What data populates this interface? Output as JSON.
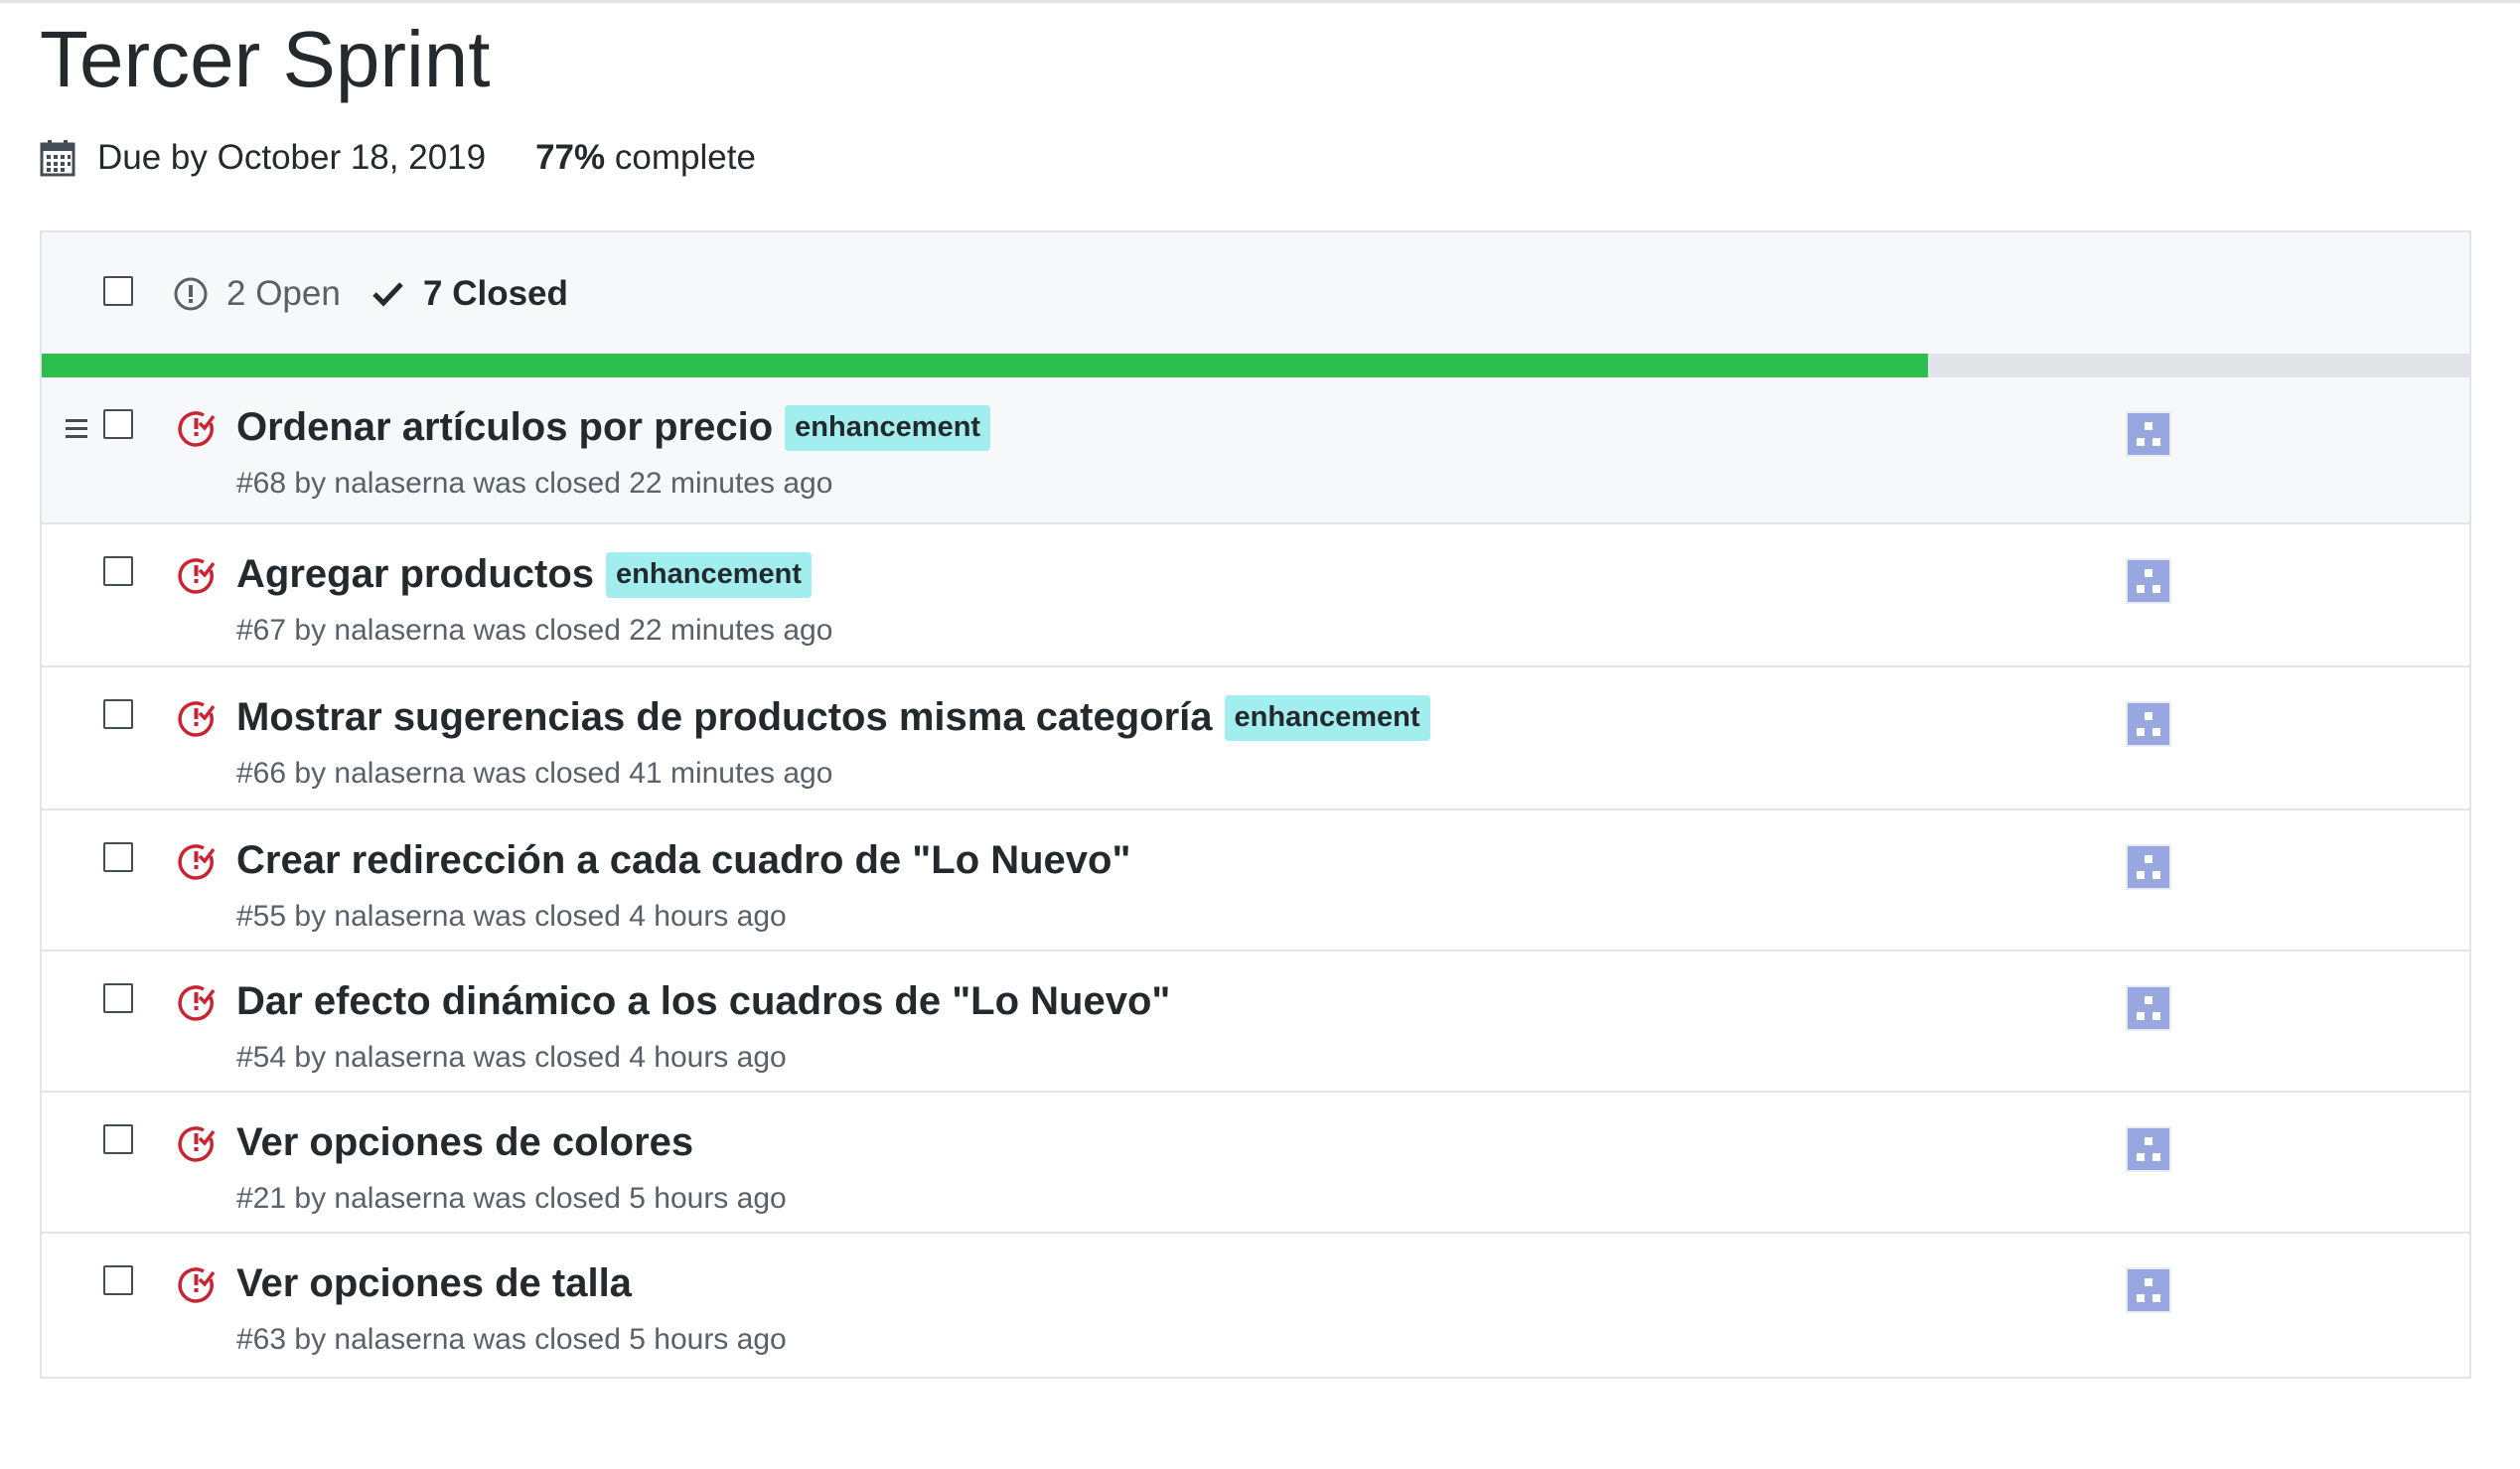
{
  "milestone": {
    "title": "Tercer Sprint",
    "due": "Due by October 18, 2019",
    "percent": "77%",
    "complete_label": "complete"
  },
  "filters": {
    "open_label": "2 Open",
    "closed_label": "7 Closed"
  },
  "progress": {
    "fraction": 0.777,
    "color": "#2cbe4e"
  },
  "colors": {
    "closed_icon": "#cb2431",
    "label_bg": "#a2eeef",
    "avatar": "#98a7df"
  },
  "issues": [
    {
      "title": "Ordenar artículos por precio",
      "label": "enhancement",
      "meta": "#68 by nalaserna was closed 22 minutes ago"
    },
    {
      "title": "Agregar productos",
      "label": "enhancement",
      "meta": "#67 by nalaserna was closed 22 minutes ago"
    },
    {
      "title": "Mostrar sugerencias de productos misma categoría",
      "label": "enhancement",
      "meta": "#66 by nalaserna was closed 41 minutes ago"
    },
    {
      "title": "Crear redirección a cada cuadro de \"Lo Nuevo\"",
      "label": "",
      "meta": "#55 by nalaserna was closed 4 hours ago"
    },
    {
      "title": "Dar efecto dinámico a los cuadros de \"Lo Nuevo\"",
      "label": "",
      "meta": "#54 by nalaserna was closed 4 hours ago"
    },
    {
      "title": "Ver opciones de colores",
      "label": "",
      "meta": "#21 by nalaserna was closed 5 hours ago"
    },
    {
      "title": "Ver opciones de talla",
      "label": "",
      "meta": "#63 by nalaserna was closed 5 hours ago"
    }
  ],
  "icons": {
    "calendar": "calendar-icon",
    "open": "issue-opened-icon",
    "closed": "check-icon",
    "issue_closed": "issue-closed-icon",
    "drag": "drag-handle-icon",
    "avatar": "identicon-avatar"
  }
}
